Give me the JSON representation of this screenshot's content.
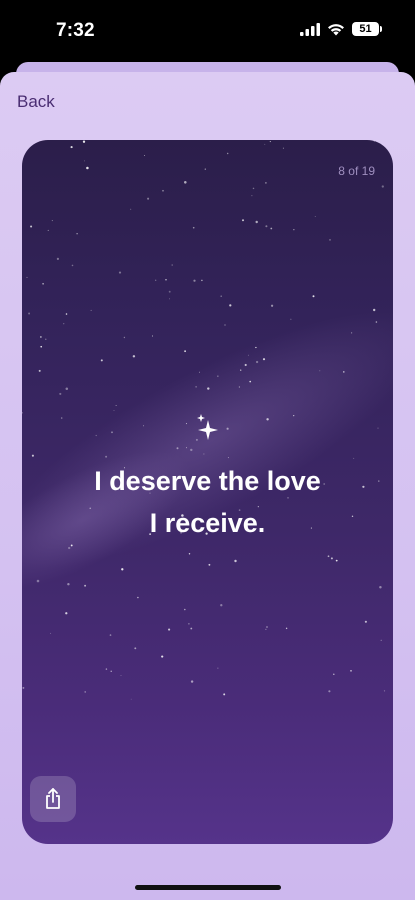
{
  "status_bar": {
    "time": "7:32",
    "battery": "51"
  },
  "nav": {
    "back_label": "Back"
  },
  "card": {
    "counter": "8 of 19",
    "affirmation_line1": "I deserve the love",
    "affirmation_line2": "I receive."
  },
  "icons": {
    "signal": "signal-icon",
    "wifi": "wifi-icon",
    "battery": "battery-icon",
    "sparkle": "sparkle-icon",
    "share": "share-icon"
  },
  "colors": {
    "sheet": "#d4c1f1",
    "card_top": "#2b1e4a",
    "card_bottom": "#55338a",
    "accent_text": "#4a2d72"
  }
}
